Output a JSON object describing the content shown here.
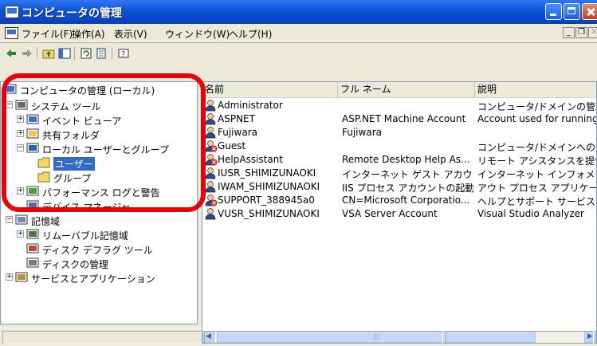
{
  "window": {
    "title": "コンピュータの管理"
  },
  "menu": {
    "items": [
      "ファイル(F)",
      "操作(A)",
      "表示(V)",
      "ウィンドウ(W)",
      "ヘルプ(H)"
    ],
    "mdi_buttons": [
      "_",
      "❐",
      "✕"
    ]
  },
  "toolbar": {
    "icons": [
      "back-arrow-icon",
      "forward-arrow-icon",
      "up-folder-icon",
      "show-hide-tree-icon",
      "refresh-icon",
      "export-list-icon",
      "help-icon"
    ]
  },
  "tree": {
    "items": [
      {
        "label": "コンピュータの管理 (ローカル)",
        "icon": "computer-management-icon",
        "expander": ""
      },
      {
        "label": "システム ツール",
        "icon": "system-tools-icon",
        "expander": "−"
      },
      {
        "label": "イベント ビューア",
        "icon": "event-viewer-icon",
        "expander": "+"
      },
      {
        "label": "共有フォルダ",
        "icon": "shared-folder-icon",
        "expander": "+"
      },
      {
        "label": "ローカル ユーザーとグループ",
        "icon": "users-groups-icon",
        "expander": "−"
      },
      {
        "label": "ユーザー",
        "icon": "folder-icon",
        "expander": "",
        "selected": true
      },
      {
        "label": "グループ",
        "icon": "folder-icon",
        "expander": ""
      },
      {
        "label": "パフォーマンス ログと警告",
        "icon": "performance-icon",
        "expander": "+"
      },
      {
        "label": "デバイス マネージャ",
        "icon": "device-manager-icon",
        "expander": ""
      },
      {
        "label": "記憶域",
        "icon": "storage-icon",
        "expander": "−"
      },
      {
        "label": "リムーバブル記憶域",
        "icon": "removable-storage-icon",
        "expander": "+"
      },
      {
        "label": "ディスク デフラグ ツール",
        "icon": "defrag-icon",
        "expander": ""
      },
      {
        "label": "ディスクの管理",
        "icon": "disk-management-icon",
        "expander": ""
      },
      {
        "label": "サービスとアプリケーション",
        "icon": "services-icon",
        "expander": "+"
      }
    ]
  },
  "list": {
    "columns": [
      "名前",
      "フル ネーム",
      "説明"
    ],
    "rows": [
      {
        "name": "Administrator",
        "full_name": "",
        "description": "コンピュータ/ドメインの管理",
        "disabled": false
      },
      {
        "name": "ASPNET",
        "full_name": "ASP.NET Machine Account",
        "description": "Account used for running",
        "disabled": false
      },
      {
        "name": "Fujiwara",
        "full_name": "Fujiwara",
        "description": "",
        "disabled": false
      },
      {
        "name": "Guest",
        "full_name": "",
        "description": "コンピュータ/ドメインへのゲ",
        "disabled": true
      },
      {
        "name": "HelpAssistant",
        "full_name": "Remote Desktop Help As...",
        "description": "リモート アシスタンスを提供",
        "disabled": true
      },
      {
        "name": "IUSR_SHIMIZUNAOKI",
        "full_name": "インターネット ゲスト アカウン...",
        "description": "インターネット インフォメーシ",
        "disabled": false
      },
      {
        "name": "IWAM_SHIMIZUNAOKI",
        "full_name": "IIS プロセス アカウントの起動",
        "description": "アウト プロセス アプリケーシ",
        "disabled": false
      },
      {
        "name": "SUPPORT_388945a0",
        "full_name": "CN=Microsoft Corporatio...",
        "description": "ヘルプとサポート サービスの",
        "disabled": true
      },
      {
        "name": "VUSR_SHIMIZUNAOKI",
        "full_name": "VSA Server Account",
        "description": "Visual Studio Analyzer",
        "disabled": false
      }
    ]
  },
  "colors": {
    "title_blue": "#0a48c8",
    "highlight_red": "#e8000b",
    "selection_blue": "#316ac5"
  }
}
